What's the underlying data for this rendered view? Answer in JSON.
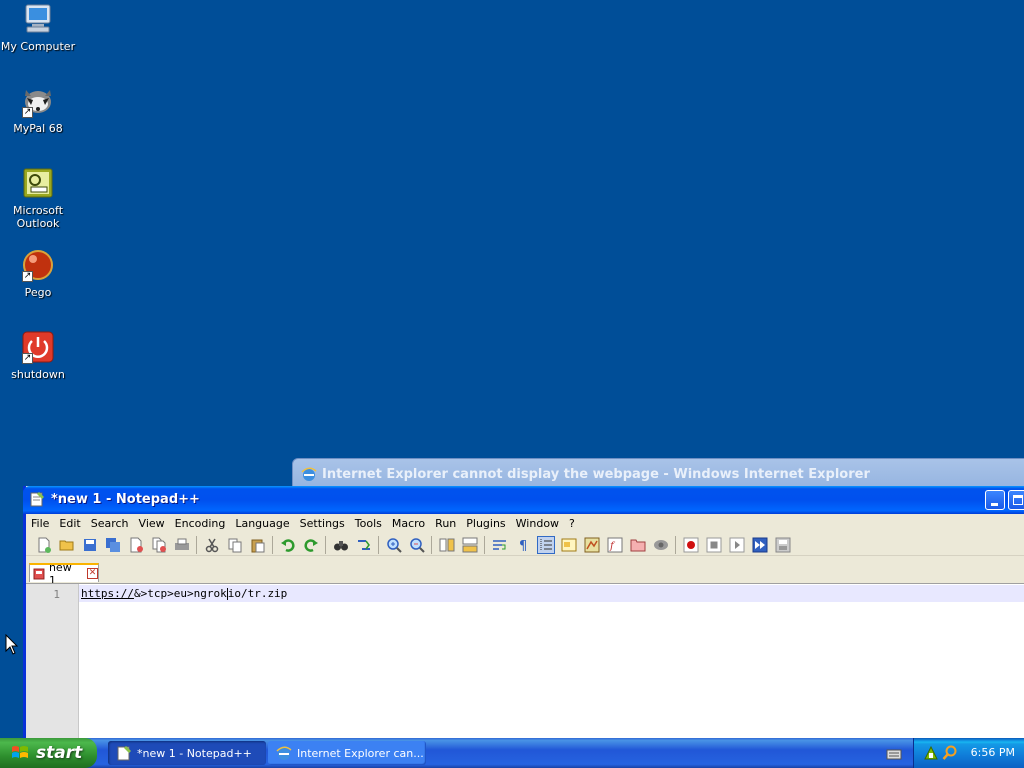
{
  "desktop": {
    "icons": [
      {
        "label": "My Computer"
      },
      {
        "label": "MyPal 68"
      },
      {
        "label_line1": "Microsoft",
        "label_line2": "Outlook"
      },
      {
        "label": "Pego"
      },
      {
        "label": "shutdown"
      }
    ]
  },
  "ie_window": {
    "title": "Internet Explorer cannot display the webpage - Windows Internet Explorer"
  },
  "notepad": {
    "title": "*new 1 - Notepad++",
    "menu": [
      "File",
      "Edit",
      "Search",
      "View",
      "Encoding",
      "Language",
      "Settings",
      "Tools",
      "Macro",
      "Run",
      "Plugins",
      "Window",
      "?"
    ],
    "tab_label": "new 1",
    "line_number": "1",
    "line_text_url": "https://",
    "line_text_rest": "&>tcp>eu>ngrok",
    "line_text_tail": "io/tr.zip"
  },
  "taskbar": {
    "start_label": "start",
    "tasks": [
      {
        "label": "*new 1 - Notepad++",
        "active": true
      },
      {
        "label": "Internet Explorer can...",
        "active": false
      }
    ],
    "clock": "6:56 PM"
  },
  "colors": {
    "desktop_bg": "#004e98",
    "title_blue": "#0050ee",
    "current_line": "#e8e8ff"
  }
}
